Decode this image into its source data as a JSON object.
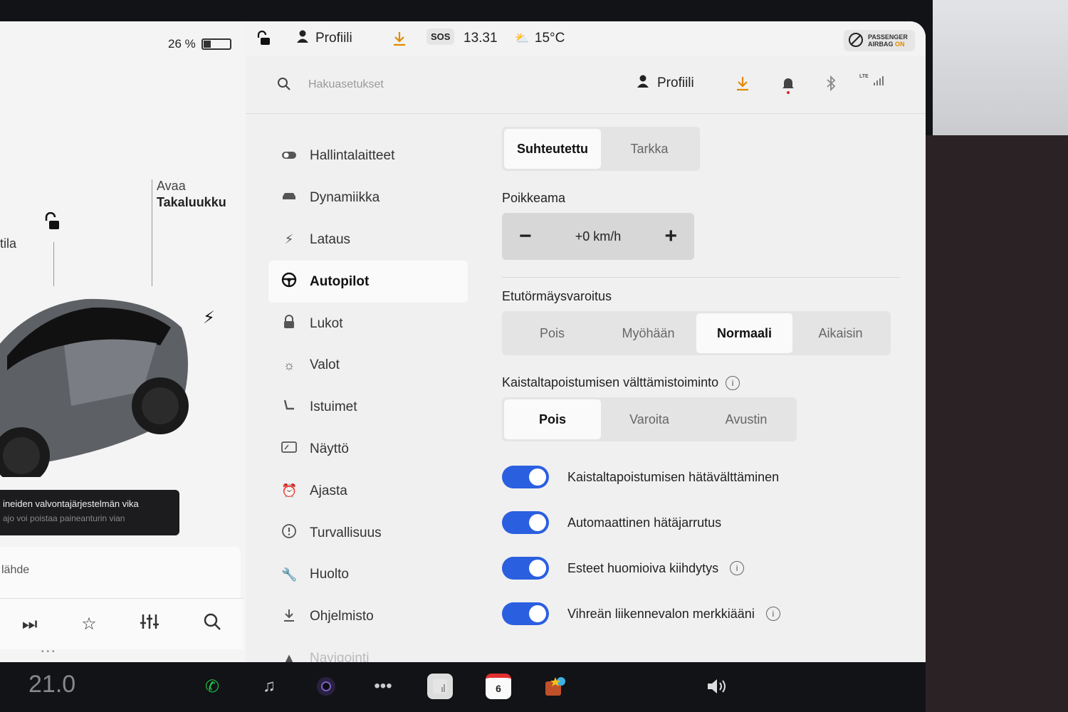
{
  "status": {
    "battery_text": "26 %",
    "battery_percent": 26,
    "profile_label": "Profiili",
    "sos_label": "SOS",
    "time": "13.31",
    "weather": "15°C",
    "airbag_line1": "PASSENGER",
    "airbag_line2": "AIRBAG",
    "airbag_state": "ON"
  },
  "car_panel": {
    "trunk_line1": "Avaa",
    "trunk_line2": "Takaluukku",
    "side_label": "tila",
    "alert_title": "ineiden valvontajärjestelmän vika",
    "alert_sub": "ajo voi poistaa paineanturin vian",
    "media_source": "lähde"
  },
  "header": {
    "search_placeholder": "Hakuasetukset",
    "profile_label": "Profiili",
    "signal_label": "LTE"
  },
  "nav": {
    "items": [
      {
        "label": "Hallintalaitteet",
        "icon": "toggle-icon"
      },
      {
        "label": "Dynamiikka",
        "icon": "car-icon"
      },
      {
        "label": "Lataus",
        "icon": "bolt-icon"
      },
      {
        "label": "Autopilot",
        "icon": "steering-wheel-icon"
      },
      {
        "label": "Lukot",
        "icon": "lock-icon"
      },
      {
        "label": "Valot",
        "icon": "sun-icon"
      },
      {
        "label": "Istuimet",
        "icon": "seat-icon"
      },
      {
        "label": "Näyttö",
        "icon": "display-icon"
      },
      {
        "label": "Ajasta",
        "icon": "alarm-icon"
      },
      {
        "label": "Turvallisuus",
        "icon": "info-circle-icon"
      },
      {
        "label": "Huolto",
        "icon": "wrench-icon"
      },
      {
        "label": "Ohjelmisto",
        "icon": "download-icon"
      },
      {
        "label": "Navigointi",
        "icon": "navigation-icon"
      }
    ],
    "active": "Autopilot"
  },
  "content": {
    "speed_mode": {
      "options": [
        "Suhteutettu",
        "Tarkka"
      ],
      "selected": "Suhteutettu"
    },
    "offset_label": "Poikkeama",
    "offset_value": "+0 km/h",
    "fcw_label": "Etutörmäysvaroitus",
    "fcw": {
      "options": [
        "Pois",
        "Myöhään",
        "Normaali",
        "Aikaisin"
      ],
      "selected": "Normaali"
    },
    "lda_label": "Kaistaltapoistumisen välttämistoiminto",
    "lda": {
      "options": [
        "Pois",
        "Varoita",
        "Avustin"
      ],
      "selected": "Pois"
    },
    "toggles": [
      {
        "label": "Kaistaltapoistumisen hätävälttäminen",
        "on": true,
        "info": false
      },
      {
        "label": "Automaattinen hätäjarrutus",
        "on": true,
        "info": false
      },
      {
        "label": "Esteet huomioiva kiihdytys",
        "on": true,
        "info": true
      },
      {
        "label": "Vihreän liikennevalon merkkiääni",
        "on": true,
        "info": true
      }
    ]
  },
  "taskbar": {
    "temperature": "21.0",
    "calendar_day": "6"
  },
  "colors": {
    "toggle_on": "#2a5fe0",
    "download_accent": "#e08a00",
    "notification_dot": "#e02020",
    "phone_green": "#1fbf4a"
  }
}
